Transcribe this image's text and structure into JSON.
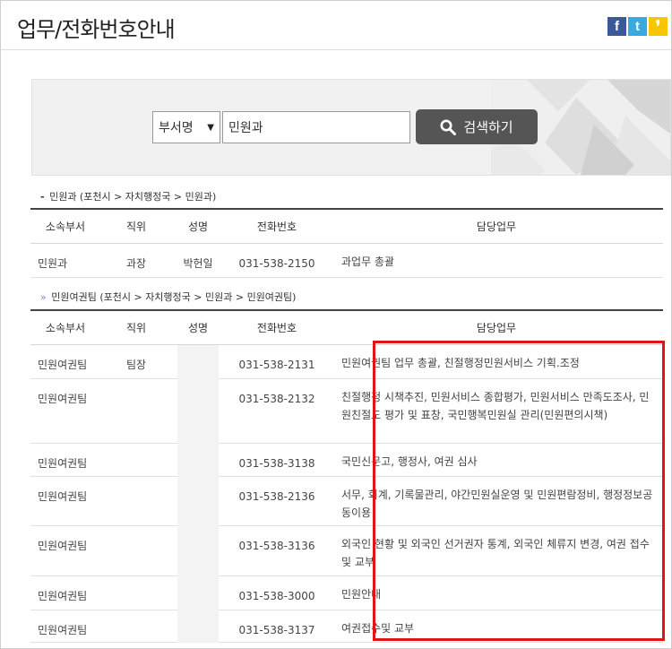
{
  "page": {
    "title": "업무/전화번호안내"
  },
  "share": {
    "facebook": "f",
    "twitter": "t",
    "kakaostory": "❜"
  },
  "search": {
    "select_value": "부서명",
    "input_value": "민원과",
    "button_label": "검색하기"
  },
  "sections": [
    {
      "breadcrumb": "민원과 (포천시 > 자치행정국 > 민원과)",
      "headers": [
        "소속부서",
        "직위",
        "성명",
        "전화번호",
        "담당업무"
      ],
      "rows": [
        {
          "dept": "민원과",
          "position": "과장",
          "name": "박헌일",
          "phone": "031-538-2150",
          "duty": "과업무 총괄"
        }
      ]
    },
    {
      "breadcrumb": "민원여권팀 (포천시 > 자치행정국 > 민원과 > 민원여권팀)",
      "headers": [
        "소속부서",
        "직위",
        "성명",
        "전화번호",
        "담당업무"
      ],
      "rows": [
        {
          "dept": "민원여권팀",
          "position": "팀장",
          "name": "",
          "phone": "031-538-2131",
          "duty": "민원여권팀 업무 총괄, 친절행정민원서비스 기획.조정"
        },
        {
          "dept": "민원여권팀",
          "position": "",
          "name": "",
          "phone": "031-538-2132",
          "duty": "친절행정 시책추진, 민원서비스 종합평가, 민원서비스 만족도조사, 민원친절도 평가 및 표창, 국민행복민원실 관리(민원편의시책)"
        },
        {
          "dept": "민원여권팀",
          "position": "",
          "name": "",
          "phone": "031-538-3138",
          "duty": "국민신문고, 행정사, 여권 심사"
        },
        {
          "dept": "민원여권팀",
          "position": "",
          "name": "",
          "phone": "031-538-2136",
          "duty": "서무, 회계, 기록물관리, 야간민원실운영 및 민원편람정비, 행정정보공동이용"
        },
        {
          "dept": "민원여권팀",
          "position": "",
          "name": "",
          "phone": "031-538-3136",
          "duty": "외국인 현황 및 외국인 선거권자 통계, 외국인 체류지 변경, 여권 접수 및 교부"
        },
        {
          "dept": "민원여권팀",
          "position": "",
          "name": "",
          "phone": "031-538-3000",
          "duty": "민원안내"
        },
        {
          "dept": "민원여권팀",
          "position": "",
          "name": "",
          "phone": "031-538-3137",
          "duty": "여권접수및 교부"
        }
      ]
    }
  ],
  "colors": {
    "highlight": "#e0151a",
    "button": "#555555",
    "panel": "#f1f1f1"
  }
}
